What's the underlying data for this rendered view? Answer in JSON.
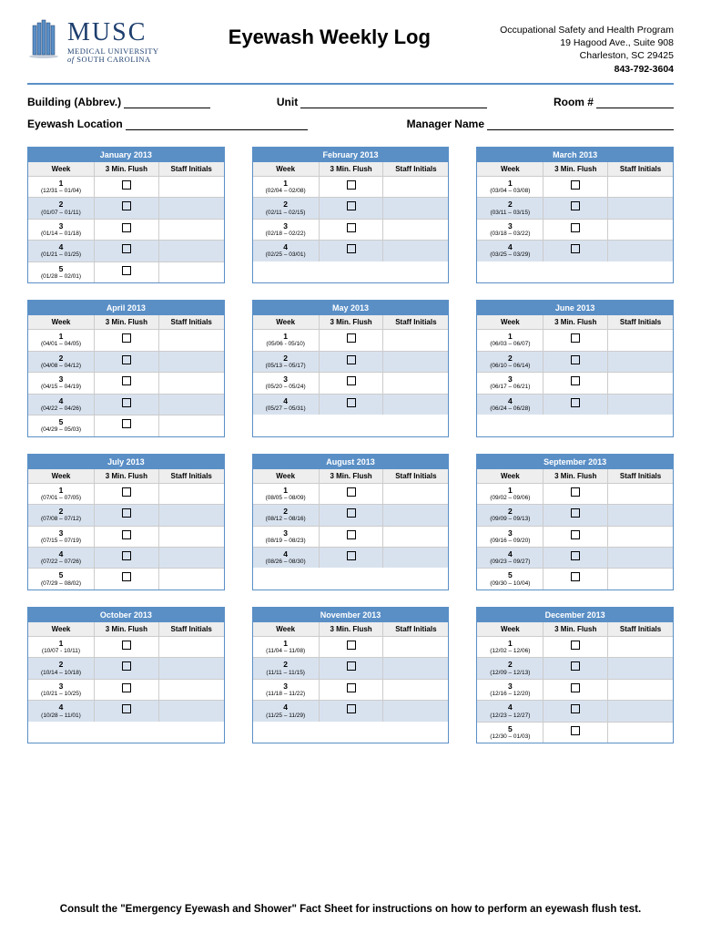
{
  "logo": {
    "main": "MUSC",
    "sub1": "MEDICAL UNIVERSITY",
    "sub2_prefix": "of ",
    "sub2": "SOUTH CAROLINA"
  },
  "title": "Eyewash Weekly Log",
  "contact": {
    "line1": "Occupational Safety and Health Program",
    "line2": "19 Hagood Ave., Suite 908",
    "line3": "Charleston, SC 29425",
    "phone": "843-792-3604"
  },
  "fields": {
    "building": "Building (Abbrev.)",
    "unit": "Unit",
    "room": "Room #",
    "location": "Eyewash Location",
    "manager": "Manager Name"
  },
  "columns": {
    "week": "Week",
    "flush": "3 Min. Flush",
    "initials": "Staff Initials"
  },
  "months": [
    {
      "title": "January 2013",
      "weeks": [
        {
          "n": "1",
          "d": "(12/31 – 01/04)"
        },
        {
          "n": "2",
          "d": "(01/07 – 01/11)"
        },
        {
          "n": "3",
          "d": "(01/14 – 01/18)"
        },
        {
          "n": "4",
          "d": "(01/21 – 01/25)"
        },
        {
          "n": "5",
          "d": "(01/28 – 02/01)"
        }
      ]
    },
    {
      "title": "February 2013",
      "weeks": [
        {
          "n": "1",
          "d": "(02/04 – 02/08)"
        },
        {
          "n": "2",
          "d": "(02/11 – 02/15)"
        },
        {
          "n": "3",
          "d": "(02/18 – 02/22)"
        },
        {
          "n": "4",
          "d": "(02/25 – 03/01)"
        }
      ]
    },
    {
      "title": "March 2013",
      "weeks": [
        {
          "n": "1",
          "d": "(03/04 – 03/08)"
        },
        {
          "n": "2",
          "d": "(03/11 – 03/15)"
        },
        {
          "n": "3",
          "d": "(03/18 – 03/22)"
        },
        {
          "n": "4",
          "d": "(03/25 – 03/29)"
        }
      ]
    },
    {
      "title": "April 2013",
      "weeks": [
        {
          "n": "1",
          "d": "(04/01 – 04/05)"
        },
        {
          "n": "2",
          "d": "(04/08 – 04/12)"
        },
        {
          "n": "3",
          "d": "(04/15 – 04/19)"
        },
        {
          "n": "4",
          "d": "(04/22 – 04/26)"
        },
        {
          "n": "5",
          "d": "(04/29 – 05/03)"
        }
      ]
    },
    {
      "title": "May 2013",
      "weeks": [
        {
          "n": "1",
          "d": "(05/06 - 05/10)"
        },
        {
          "n": "2",
          "d": "(05/13 – 05/17)"
        },
        {
          "n": "3",
          "d": "(05/20 – 05/24)"
        },
        {
          "n": "4",
          "d": "(05/27 – 05/31)"
        }
      ]
    },
    {
      "title": "June 2013",
      "weeks": [
        {
          "n": "1",
          "d": "(06/03 – 06/07)"
        },
        {
          "n": "2",
          "d": "(06/10 – 06/14)"
        },
        {
          "n": "3",
          "d": "(06/17 – 06/21)"
        },
        {
          "n": "4",
          "d": "(06/24 – 06/28)"
        }
      ]
    },
    {
      "title": "July 2013",
      "weeks": [
        {
          "n": "1",
          "d": "(07/01 – 07/05)"
        },
        {
          "n": "2",
          "d": "(07/08 – 07/12)"
        },
        {
          "n": "3",
          "d": "(07/15 – 07/19)"
        },
        {
          "n": "4",
          "d": "(07/22 – 07/26)"
        },
        {
          "n": "5",
          "d": "(07/29 – 08/02)"
        }
      ]
    },
    {
      "title": "August 2013",
      "weeks": [
        {
          "n": "1",
          "d": "(08/05 – 08/09)"
        },
        {
          "n": "2",
          "d": "(08/12 – 08/16)"
        },
        {
          "n": "3",
          "d": "(08/19 – 08/23)"
        },
        {
          "n": "4",
          "d": "(08/26 – 08/30)"
        }
      ]
    },
    {
      "title": "September 2013",
      "weeks": [
        {
          "n": "1",
          "d": "(09/02 – 09/06)"
        },
        {
          "n": "2",
          "d": "(09/09 – 09/13)"
        },
        {
          "n": "3",
          "d": "(09/16 – 09/20)"
        },
        {
          "n": "4",
          "d": "(09/23 – 09/27)"
        },
        {
          "n": "5",
          "d": "(09/30 – 10/04)"
        }
      ]
    },
    {
      "title": "October 2013",
      "weeks": [
        {
          "n": "1",
          "d": "(10/07 - 10/11)"
        },
        {
          "n": "2",
          "d": "(10/14 – 10/18)"
        },
        {
          "n": "3",
          "d": "(10/21 – 10/25)"
        },
        {
          "n": "4",
          "d": "(10/28 – 11/01)"
        }
      ]
    },
    {
      "title": "November 2013",
      "weeks": [
        {
          "n": "1",
          "d": "(11/04 – 11/08)"
        },
        {
          "n": "2",
          "d": "(11/11 – 11/15)"
        },
        {
          "n": "3",
          "d": "(11/18 – 11/22)"
        },
        {
          "n": "4",
          "d": "(11/25 – 11/29)"
        }
      ]
    },
    {
      "title": "December 2013",
      "weeks": [
        {
          "n": "1",
          "d": "(12/02 – 12/06)"
        },
        {
          "n": "2",
          "d": "(12/09 – 12/13)"
        },
        {
          "n": "3",
          "d": "(12/16 – 12/20)"
        },
        {
          "n": "4",
          "d": "(12/23 – 12/27)"
        },
        {
          "n": "5",
          "d": "(12/30 – 01/03)"
        }
      ]
    }
  ],
  "footer": "Consult the \"Emergency Eyewash and Shower\" Fact Sheet for instructions on how to perform an eyewash flush test."
}
